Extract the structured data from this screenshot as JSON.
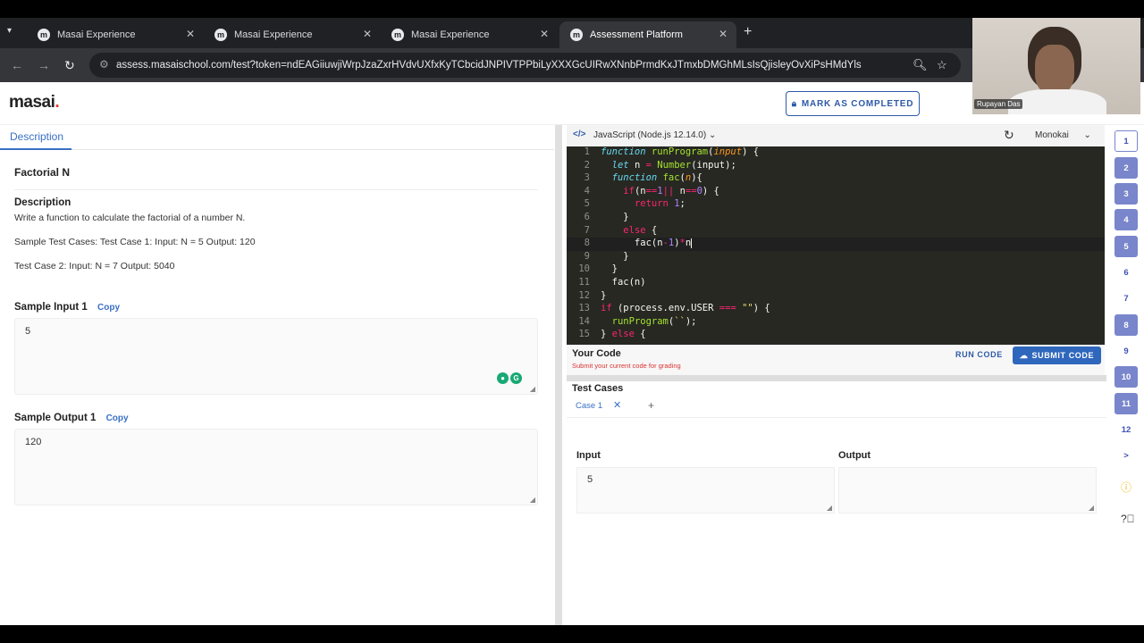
{
  "browser": {
    "tabs": [
      {
        "title": "Masai Experience",
        "active": false
      },
      {
        "title": "Masai Experience",
        "active": false
      },
      {
        "title": "Masai Experience",
        "active": false
      },
      {
        "title": "Assessment Platform",
        "active": true
      }
    ],
    "favicon_letter": "m",
    "url": "assess.masaischool.com/test?token=ndEAGiiuwjiWrpJzaZxrHVdvUXfxKyTCbcidJNPIVTPPbiLyXXXGcUIRwXNnbPrmdKxJTmxbDMGhMLsIsQjisleyOvXiPsHMdYls"
  },
  "header": {
    "logo_text": "masai",
    "logo_dot": ".",
    "mark_completed_label": "MARK AS COMPLETED"
  },
  "problem": {
    "tab_label": "Description",
    "title": "Factorial N",
    "description_heading": "Description",
    "description_lines": [
      "Write a function to calculate the factorial of a number N.",
      "Sample Test Cases: Test Case 1: Input: N = 5 Output: 120",
      "Test Case 2: Input: N = 7 Output: 5040"
    ],
    "sample_input_label": "Sample Input 1",
    "sample_input_value": "5",
    "sample_output_label": "Sample Output 1",
    "sample_output_value": "120",
    "copy_label": "Copy"
  },
  "editor": {
    "language": "JavaScript (Node.js 12.14.0)",
    "theme": "Monokai",
    "line_numbers": [
      "1",
      "2",
      "3",
      "4",
      "5",
      "6",
      "7",
      "8",
      "9",
      "10",
      "11",
      "12",
      "13",
      "14",
      "15"
    ],
    "your_code_label": "Your Code",
    "your_code_sub": "Submit your current code for grading",
    "run_label": "RUN CODE",
    "submit_label": "SUBMIT CODE"
  },
  "test_cases": {
    "heading": "Test Cases",
    "case_tab": "Case 1",
    "add_symbol": "+",
    "input_label": "Input",
    "input_value": "5",
    "output_label": "Output",
    "output_value": ""
  },
  "question_nav": {
    "items": [
      {
        "label": "1",
        "state": "current"
      },
      {
        "label": "2",
        "state": "done"
      },
      {
        "label": "3",
        "state": "done"
      },
      {
        "label": "4",
        "state": "done"
      },
      {
        "label": "5",
        "state": "done"
      },
      {
        "label": "6",
        "state": "todo"
      },
      {
        "label": "7",
        "state": "todo"
      },
      {
        "label": "8",
        "state": "done"
      },
      {
        "label": "9",
        "state": "todo"
      },
      {
        "label": "10",
        "state": "done"
      },
      {
        "label": "11",
        "state": "done"
      },
      {
        "label": "12",
        "state": "todo"
      }
    ],
    "next_symbol": ">"
  },
  "webcam": {
    "name": "Rupayan Das"
  },
  "colors": {
    "accent": "#2f67bd",
    "editor_bg": "#272822",
    "nav_done": "#7986cb"
  }
}
